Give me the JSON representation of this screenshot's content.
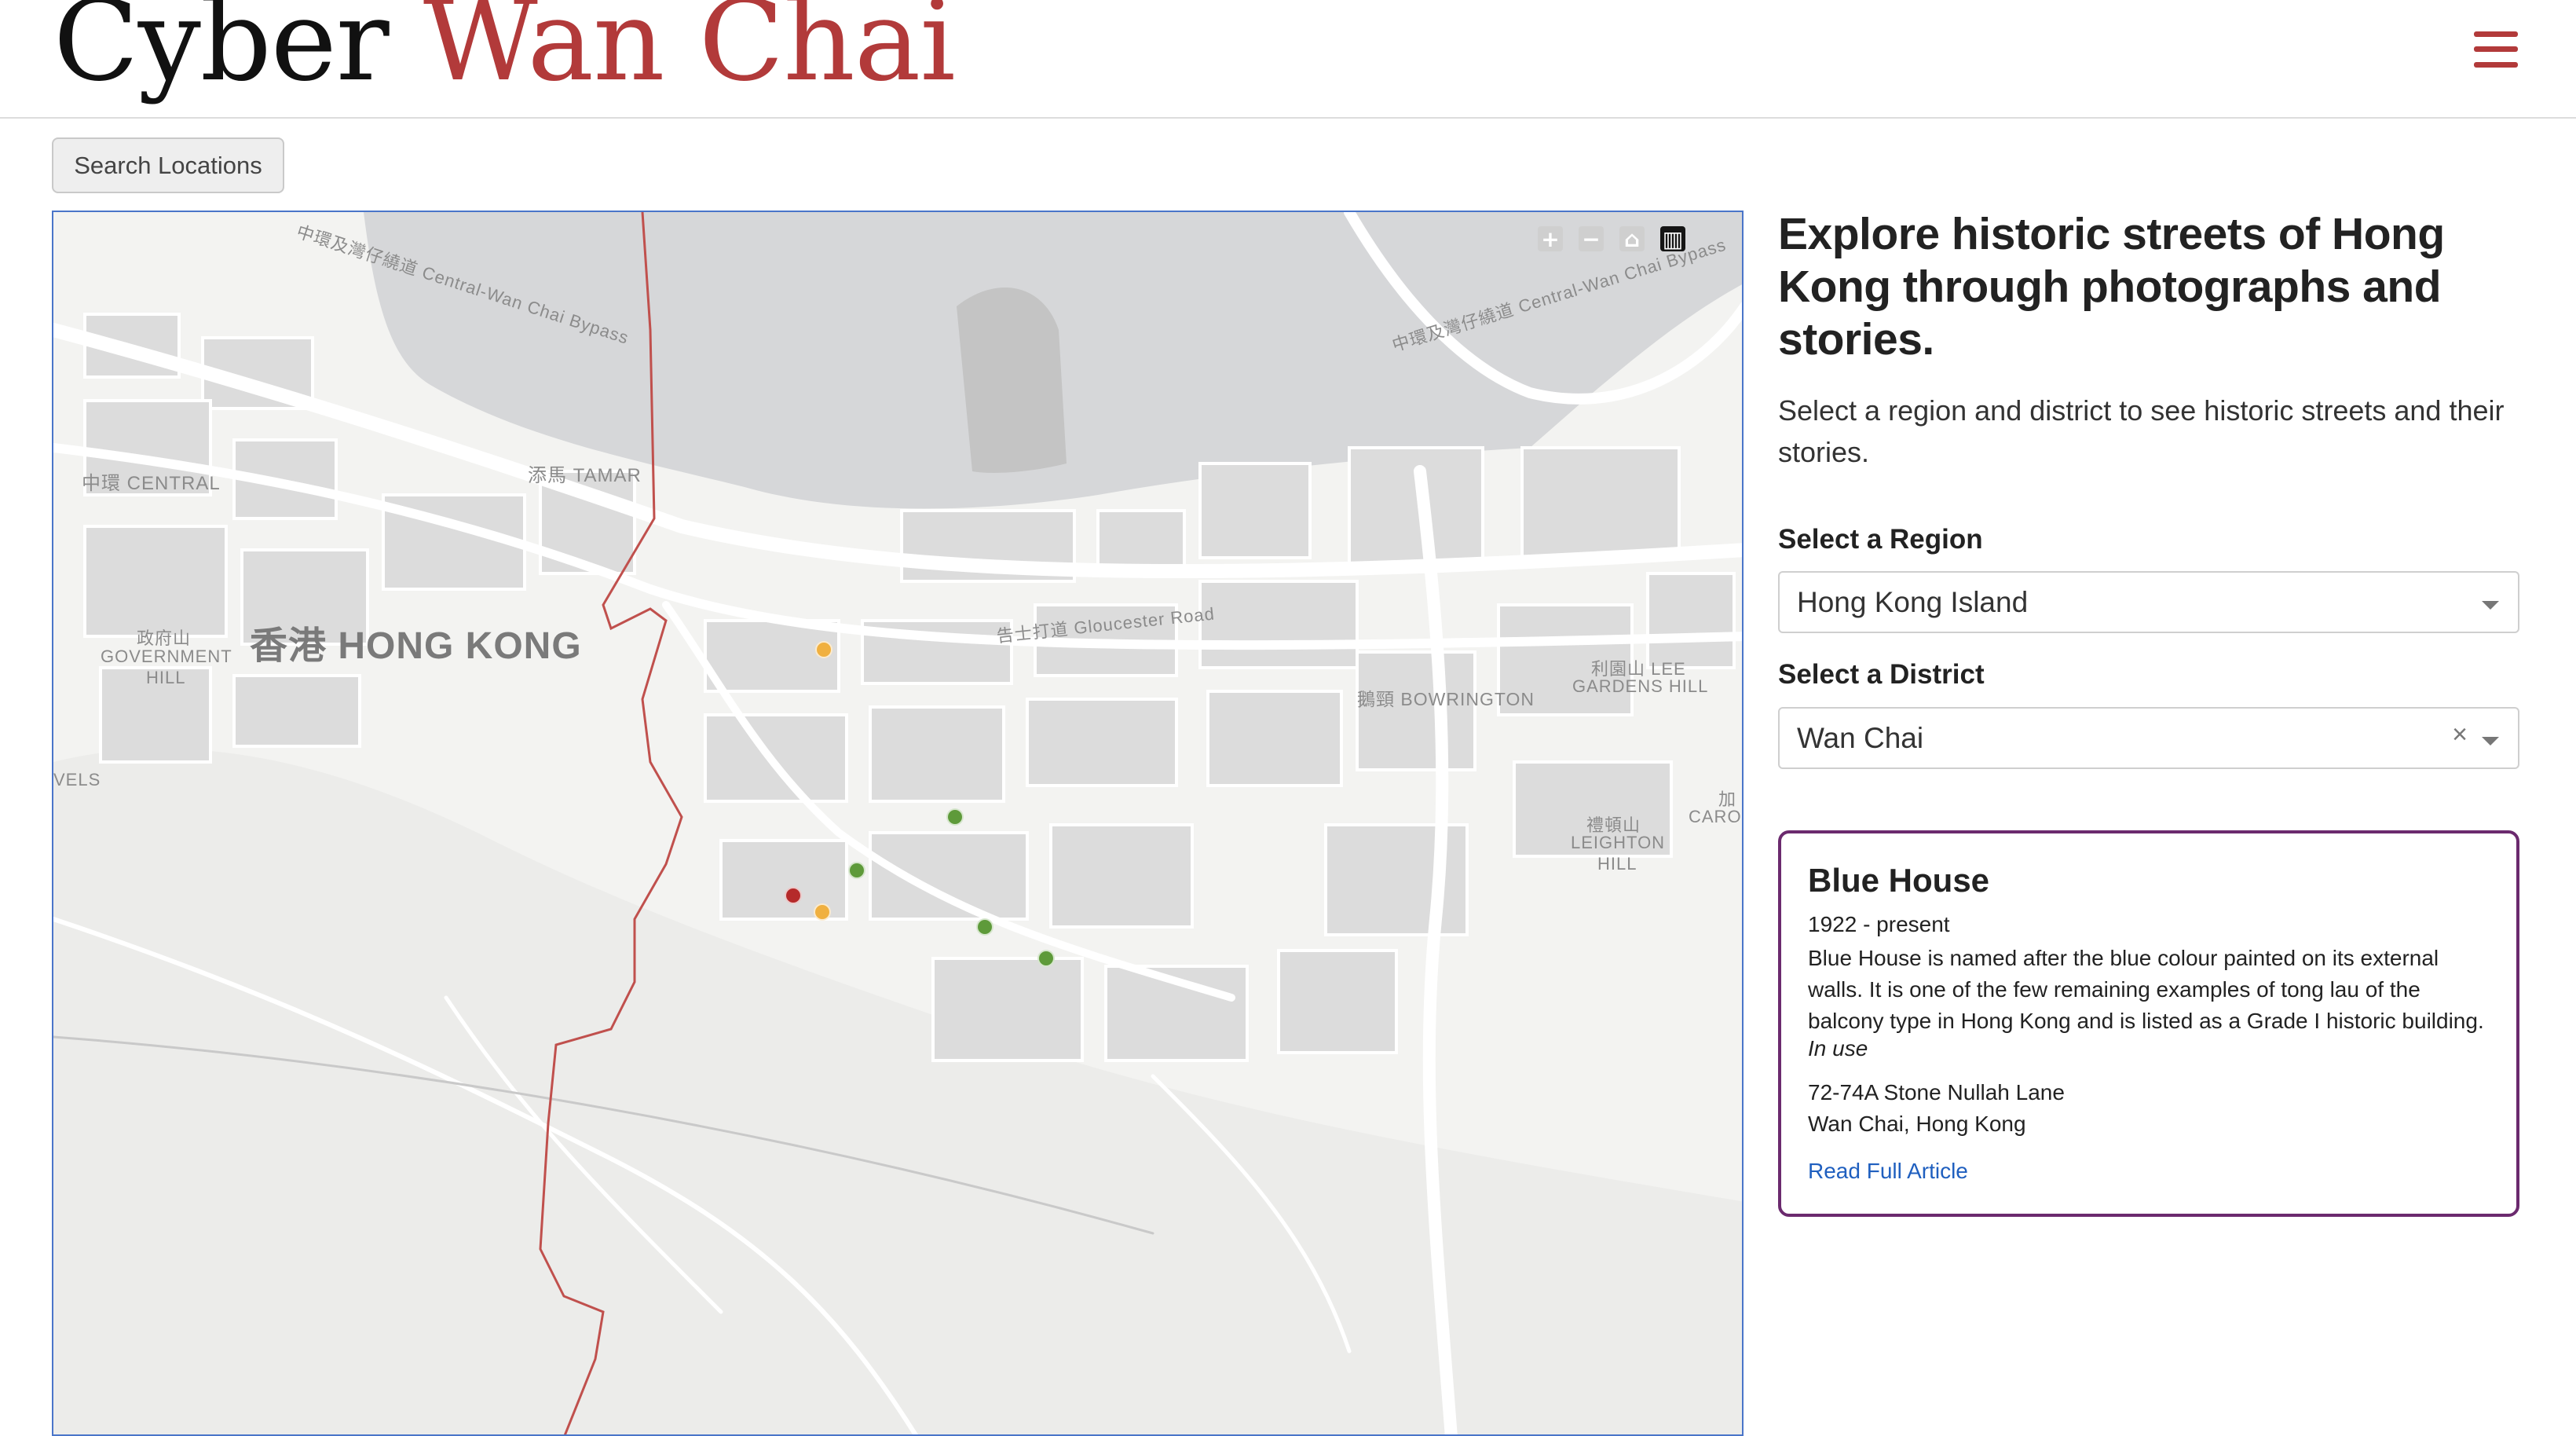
{
  "header": {
    "title_part1": "Cyber",
    "title_part2": "Wan Chai",
    "menu_icon": "hamburger-menu-icon",
    "brand_color": "#b23a3a"
  },
  "search_button": {
    "label": "Search Locations"
  },
  "map": {
    "labels": {
      "central": "中環 CENTRAL",
      "tamar": "添馬 TAMAR",
      "hong_kong": "香港 HONG KONG",
      "gov_hill_1": "政府山",
      "gov_hill_2": "GOVERNMENT",
      "gov_hill_3": "HILL",
      "vels": "VELS",
      "bypass_1": "中環及灣仔繞道 Central-Wan Chai Bypass",
      "bypass_2": "中環及灣仔繞道 Central-Wan Chai Bypass",
      "gloucester": "告士打道 Gloucester Road",
      "bowrington": "鵝頸 BOWRINGTON",
      "lee_gardens_1": "利園山 LEE",
      "lee_gardens_2": "GARDENS HILL",
      "leighton_1": "禮頓山",
      "leighton_2": "LEIGHTON",
      "leighton_3": "HILL",
      "caro_1": "加",
      "caro_2": "CAROL"
    },
    "controls": [
      {
        "name": "zoom-in-icon",
        "glyph": "+"
      },
      {
        "name": "zoom-out-icon",
        "glyph": "−"
      },
      {
        "name": "home-icon",
        "glyph": "⌂"
      },
      {
        "name": "legend-chart-icon",
        "glyph": "▥"
      }
    ],
    "marker_colors": {
      "orange": "#f0b040",
      "green": "#5e9a3a",
      "red": "#b52a2a"
    },
    "boundary_color": "#c0504d"
  },
  "panel": {
    "title": "Explore historic streets of Hong Kong through photographs and stories.",
    "intro": "Select a region and district to see historic streets and their stories.",
    "region_label": "Select a Region",
    "region_value": "Hong Kong Island",
    "district_label": "Select a District",
    "district_value": "Wan Chai",
    "clear_glyph": "×"
  },
  "card": {
    "title": "Blue House",
    "dates": "1922 - present",
    "description": "Blue House is named after the blue colour painted on its external walls. It is one of the few remaining examples of tong lau of the balcony type in Hong Kong and is listed as a Grade I historic building.",
    "status": "In use",
    "address_line1": "72-74A Stone Nullah Lane",
    "address_line2": "Wan Chai, Hong Kong",
    "link_label": "Read Full Article",
    "border_color": "#6b2a6e"
  }
}
